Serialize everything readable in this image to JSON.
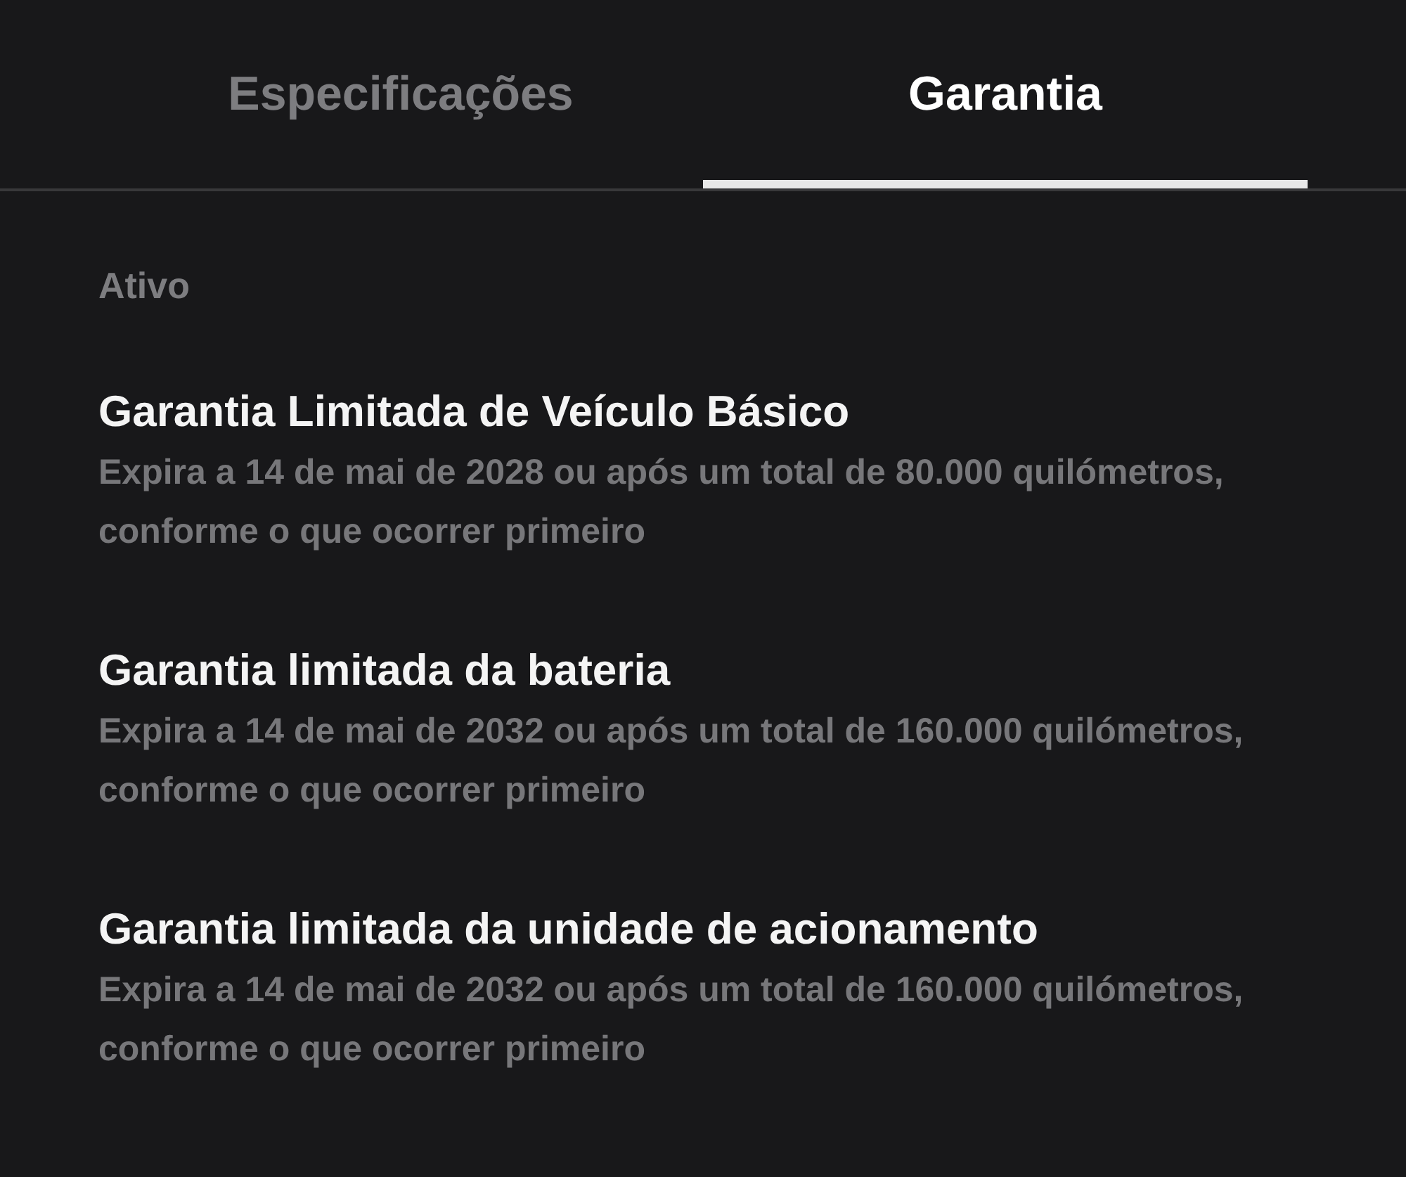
{
  "tabs": [
    {
      "label": "Especificações",
      "selected": false
    },
    {
      "label": "Garantia",
      "selected": true
    }
  ],
  "section": {
    "label": "Ativo"
  },
  "warranties": [
    {
      "title": "Garantia Limitada de Veículo Básico",
      "description": "Expira a 14 de mai de 2028 ou após um total de 80.000 quilómetros, conforme o que ocorrer primeiro"
    },
    {
      "title": "Garantia limitada da bateria",
      "description": "Expira a 14 de mai de 2032 ou após um total de 160.000 quilómetros, conforme o que ocorrer primeiro"
    },
    {
      "title": "Garantia limitada da unidade de acionamento",
      "description": "Expira a 14 de mai de 2032 ou após um total de 160.000 quilómetros, conforme o que ocorrer primeiro"
    }
  ]
}
